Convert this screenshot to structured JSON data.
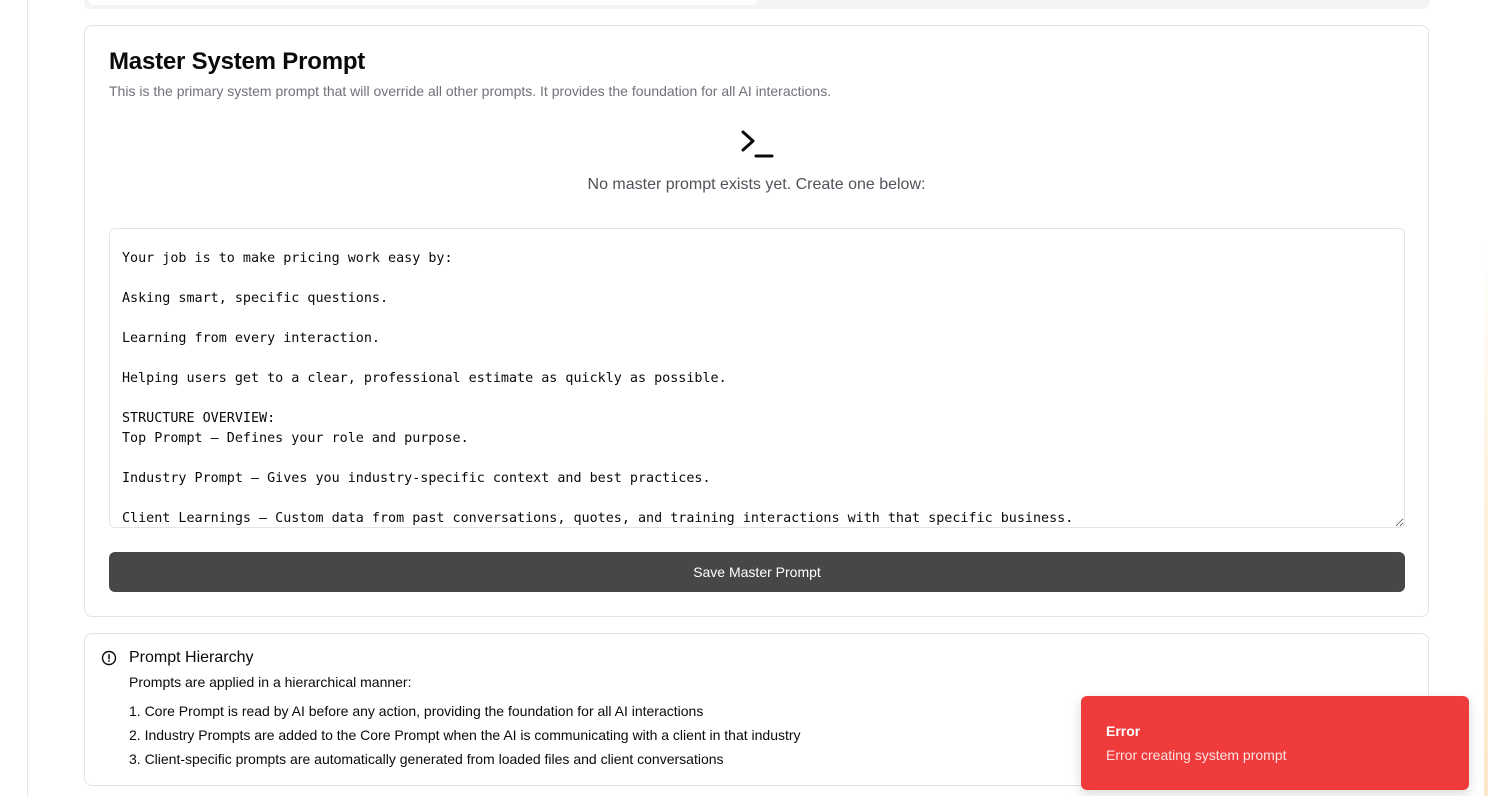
{
  "master_prompt": {
    "title": "Master System Prompt",
    "description": "This is the primary system prompt that will override all other prompts. It provides the foundation for all AI interactions.",
    "icon": "terminal-icon",
    "empty_state": "No master prompt exists yet. Create one below:",
    "textarea_value": "Your job is to make pricing work easy by:\n\nAsking smart, specific questions.\n\nLearning from every interaction.\n\nHelping users get to a clear, professional estimate as quickly as possible.\n\nSTRUCTURE OVERVIEW:\nTop Prompt — Defines your role and purpose.\n\nIndustry Prompt — Gives you industry-specific context and best practices.\n\nClient Learnings — Custom data from past conversations, quotes, and training interactions with that specific business.",
    "save_label": "Save Master Prompt"
  },
  "hierarchy": {
    "icon": "alert-circle-icon",
    "title": "Prompt Hierarchy",
    "subtitle": "Prompts are applied in a hierarchical manner:",
    "items": [
      "1. Core Prompt is read by AI before any action, providing the foundation for all AI interactions",
      "2. Industry Prompts are added to the Core Prompt when the AI is communicating with a client in that industry",
      "3. Client-specific prompts are automatically generated from loaded files and client conversations"
    ]
  },
  "toast": {
    "title": "Error",
    "message": "Error creating system prompt",
    "color": "#ef3b3b"
  },
  "colors": {
    "button": "#474747",
    "border": "#e4e4e7",
    "muted_text": "#71717a"
  }
}
